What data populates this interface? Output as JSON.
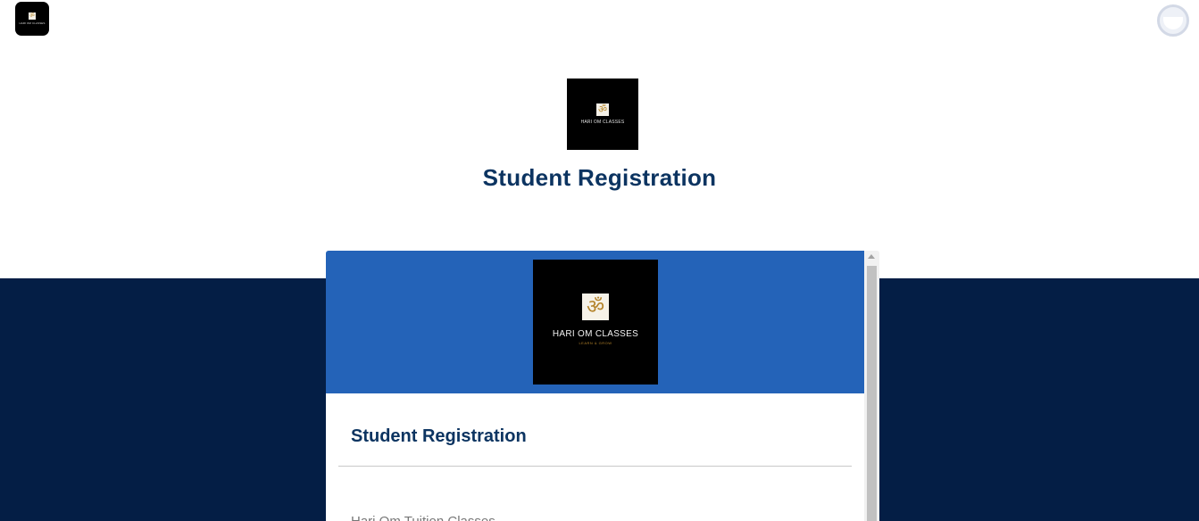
{
  "app_icon": {
    "om": "ॐ",
    "text": "HARI OM CLASSES"
  },
  "header": {
    "logo": {
      "om": "ॐ",
      "text": "HARI OM CLASSES"
    },
    "title": "Student Registration"
  },
  "form": {
    "banner_logo": {
      "om": "ॐ",
      "text": "HARI OM CLASSES",
      "sub": "LEARN & GROW"
    },
    "title": "Student Registration",
    "description": "Hari Om Tuition Classes"
  },
  "colors": {
    "title": "#0c3461",
    "dark_band": "#041e45",
    "form_banner": "#2463b8"
  }
}
